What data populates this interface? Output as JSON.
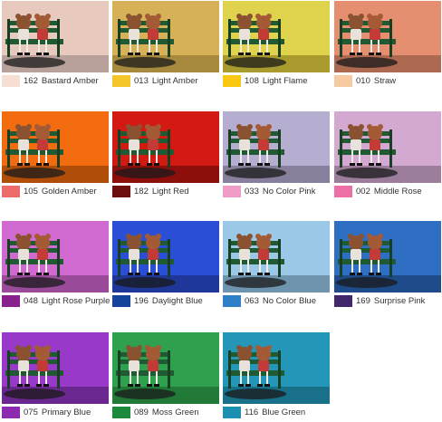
{
  "filters": [
    {
      "code": "162",
      "name": "Bastard Amber",
      "swatch": "#f6ded3",
      "bg": "#e7c9bd",
      "floor": "#b8a19a"
    },
    {
      "code": "013",
      "name": "Light Amber",
      "swatch": "#f5c62c",
      "bg": "#d6b158",
      "floor": "#a88a3f"
    },
    {
      "code": "108",
      "name": "Light Flame",
      "swatch": "#f8c813",
      "bg": "#dfd24d",
      "floor": "#a99b2d"
    },
    {
      "code": "010",
      "name": "Straw",
      "swatch": "#f7cba1",
      "bg": "#e58e70",
      "floor": "#ad6a50"
    },
    {
      "code": "105",
      "name": "Golden Amber",
      "swatch": "#ee6b6c",
      "bg": "#f26b0e",
      "floor": "#b04d08"
    },
    {
      "code": "182",
      "name": "Light Red",
      "swatch": "#6d0e0f",
      "bg": "#d21a13",
      "floor": "#8d0f0c"
    },
    {
      "code": "033",
      "name": "No Color Pink",
      "swatch": "#ef9dc7",
      "bg": "#b6aed0",
      "floor": "#877f9c"
    },
    {
      "code": "002",
      "name": "Middle Rose",
      "swatch": "#ec6fa6",
      "bg": "#d3a9d2",
      "floor": "#9c7d9b"
    },
    {
      "code": "048",
      "name": "Light Rose Purple",
      "swatch": "#88218c",
      "bg": "#d06ad0",
      "floor": "#9a4c9a"
    },
    {
      "code": "196",
      "name": "Daylight Blue",
      "swatch": "#16449c",
      "bg": "#2a4ed6",
      "floor": "#1e3799"
    },
    {
      "code": "063",
      "name": "No Color Blue",
      "swatch": "#3080c8",
      "bg": "#9cc8e8",
      "floor": "#6f94ae"
    },
    {
      "code": "169",
      "name": "Surprise Pink",
      "swatch": "#41286b",
      "bg": "#2e6fc4",
      "floor": "#1e4c8a"
    },
    {
      "code": "075",
      "name": "Primary Blue",
      "swatch": "#8c2bb0",
      "bg": "#9939c9",
      "floor": "#6b2790"
    },
    {
      "code": "089",
      "name": "Moss Green",
      "swatch": "#1c8a3a",
      "bg": "#2fa04e",
      "floor": "#217a38"
    },
    {
      "code": "116",
      "name": "Blue Green",
      "swatch": "#1d8fb0",
      "bg": "#2497b8",
      "floor": "#187089"
    }
  ]
}
